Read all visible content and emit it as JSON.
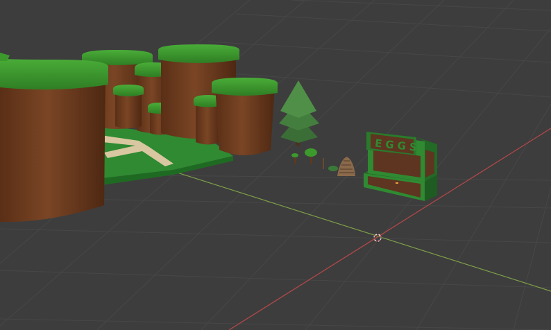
{
  "viewport": {
    "background": "#3d3d3d",
    "grid_color": "#4a4a4a",
    "x_axis_color": "#c84a4a",
    "y_axis_color": "#8ab04a"
  },
  "scene_objects": [
    {
      "name": "dirt-pillar",
      "top_color": "#3c9a2c",
      "side_color": "#6b3a1e"
    },
    {
      "name": "grass-ground-tile",
      "color": "#2f8a32",
      "path_color": "#d8c7a0"
    },
    {
      "name": "pine-tree",
      "color": "#3f7a3a",
      "trunk_color": "#5a3a22"
    },
    {
      "name": "small-bush-tree",
      "color": "#3c9a2c"
    },
    {
      "name": "pine-cone",
      "color": "#8a6a4a"
    },
    {
      "name": "eggs-stall",
      "color": "#2f8a32",
      "wood_color": "#6b3a1e"
    }
  ],
  "stall": {
    "sign_text": "EGGS"
  },
  "cursor": {
    "name": "3d-cursor"
  }
}
